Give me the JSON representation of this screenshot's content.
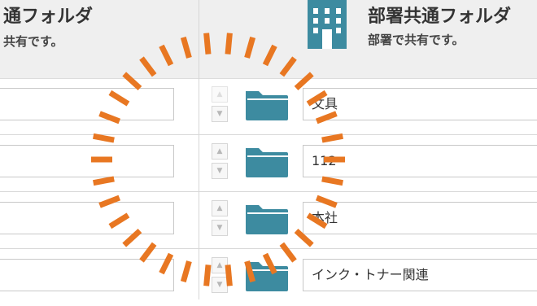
{
  "left_header": {
    "title": "通フォルダ",
    "subtitle": "共有です。"
  },
  "right_header": {
    "icon": "building-icon",
    "title": "部署共通フォルダ",
    "subtitle": "部署で共有です。"
  },
  "folders": [
    {
      "name": "文具",
      "left_value": "",
      "up_disabled": true
    },
    {
      "name": "112",
      "left_value": "",
      "up_disabled": false
    },
    {
      "name": "本社",
      "left_value": "",
      "up_disabled": false
    },
    {
      "name": "インク・トナー関連",
      "left_value": "",
      "up_disabled": false
    }
  ],
  "colors": {
    "folder": "#3d8ba0",
    "building": "#3d8ba0",
    "highlight_circle": "#e87722",
    "header_bg": "#efefef"
  }
}
